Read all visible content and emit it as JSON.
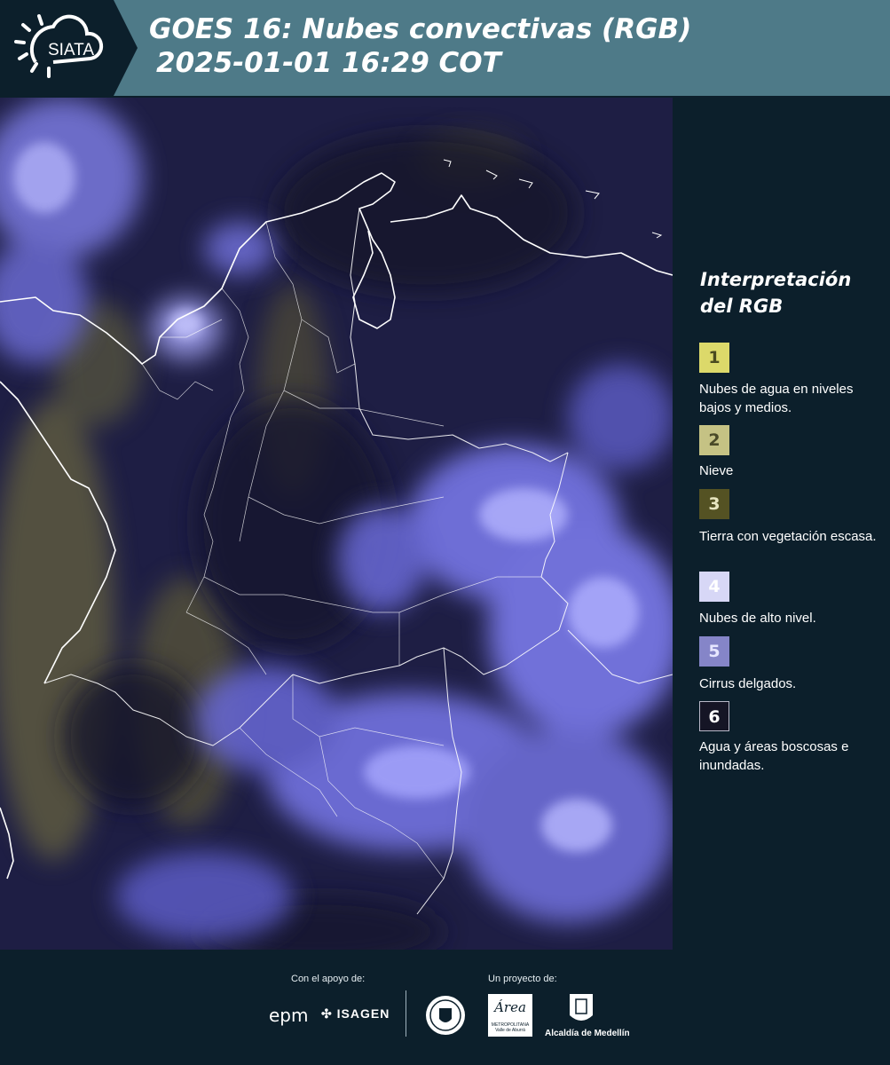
{
  "header": {
    "logo_text": "SIATA",
    "title_line1": "GOES 16: Nubes convectivas (RGB)",
    "title_line2": "2025-01-01 16:29 COT"
  },
  "legend": {
    "title_line1": "Interpretación",
    "title_line2": "del RGB",
    "items": [
      {
        "number": "1",
        "color": "#dcd96a",
        "text_color": "#4a4a20",
        "label": "Nubes de agua en niveles bajos y medios."
      },
      {
        "number": "2",
        "color": "#c5c284",
        "text_color": "#4a4a28",
        "label": "Nieve"
      },
      {
        "number": "3",
        "color": "#545223",
        "text_color": "#e8e6c0",
        "label": "Tierra con vegetación escasa."
      },
      {
        "number": "4",
        "color": "#d7d7f6",
        "text_color": "#ffffff",
        "label": "Nubes de alto nivel."
      },
      {
        "number": "5",
        "color": "#8585c8",
        "text_color": "#e6e6ff",
        "label": "Cirrus delgados."
      },
      {
        "number": "6",
        "color": "#151525",
        "text_color": "#ffffff",
        "label": "Agua y áreas boscosas e inundadas."
      }
    ]
  },
  "footer": {
    "support_label": "Con el apoyo de:",
    "project_label": "Un proyecto de:",
    "sponsor1": "epm",
    "sponsor2": "ISAGEN",
    "partner1_lines": [
      "METROPOLITANA",
      "Valle de Aburrá"
    ],
    "partner1_script": "Área",
    "partner2": "Alcaldía de Medellín"
  },
  "colors": {
    "header_bg": "#4e7a88",
    "page_bg": "#0c1f2b",
    "map_base": "#20204a",
    "cloud_high": "#8c8cff"
  }
}
